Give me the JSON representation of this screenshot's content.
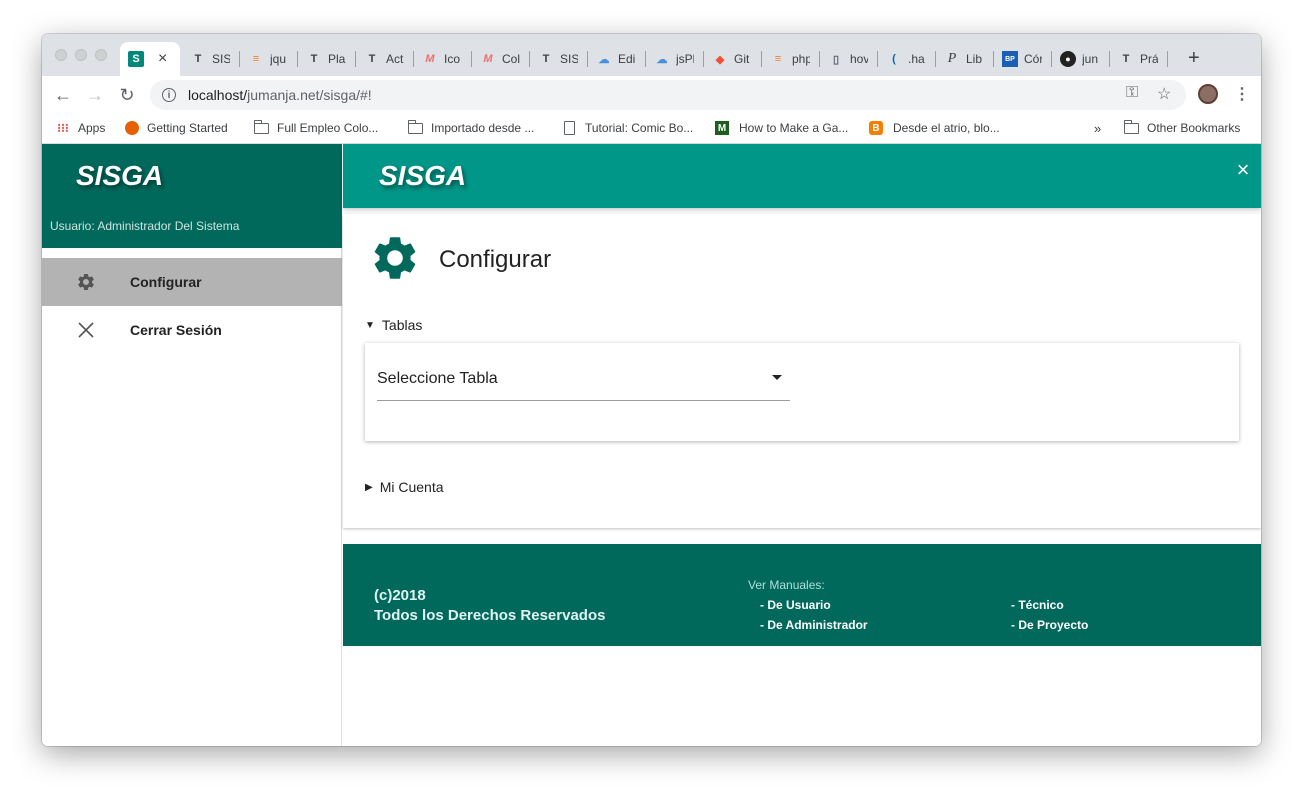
{
  "browser": {
    "tabs": [
      {
        "icon": "sisga-favicon",
        "label": "",
        "close": "×"
      },
      {
        "icon": "t-favicon",
        "label": "SIS"
      },
      {
        "icon": "stackoverflow-icon",
        "label": "jqu"
      },
      {
        "icon": "t-favicon",
        "label": "Pla"
      },
      {
        "icon": "t-favicon",
        "label": "Act"
      },
      {
        "icon": "materialize-icon",
        "label": "Ico"
      },
      {
        "icon": "materialize-icon",
        "label": "Col"
      },
      {
        "icon": "t-favicon",
        "label": "SIS"
      },
      {
        "icon": "cloud-icon",
        "label": "Edi"
      },
      {
        "icon": "cloud-icon",
        "label": "jsPl"
      },
      {
        "icon": "git-icon",
        "label": "Git"
      },
      {
        "icon": "stackoverflow-icon",
        "label": "php"
      },
      {
        "icon": "document-icon",
        "label": "hov"
      },
      {
        "icon": "jquery-icon",
        "label": ".ha"
      },
      {
        "icon": "p-favicon",
        "label": "Lib"
      },
      {
        "icon": "bp-favicon",
        "label": "Cór"
      },
      {
        "icon": "github-icon",
        "label": "jun"
      },
      {
        "icon": "t-favicon",
        "label": "Prá"
      }
    ],
    "new_tab": "+",
    "url_host": "localhost/",
    "url_path": "jumanja.net/sisga/#!",
    "bookmarks": [
      {
        "icon": "apps-grid-icon",
        "label": "Apps"
      },
      {
        "icon": "firefox-icon",
        "label": "Getting Started"
      },
      {
        "icon": "folder-icon",
        "label": "Full Empleo Colo..."
      },
      {
        "icon": "folder-icon",
        "label": "Importado desde ..."
      },
      {
        "icon": "document-icon",
        "label": "Tutorial: Comic Bo..."
      },
      {
        "icon": "m-favicon",
        "label": "How to Make a Ga..."
      },
      {
        "icon": "blogger-icon",
        "label": "Desde el atrio, blo..."
      }
    ],
    "bookmarks_overflow": "»",
    "other_bookmarks": "Other Bookmarks"
  },
  "sidebar": {
    "brand": "SISGA",
    "user": "Usuario: Administrador Del Sistema",
    "items": [
      {
        "icon": "gear-icon",
        "label": "Configurar",
        "active": true
      },
      {
        "icon": "close-icon",
        "label": "Cerrar Sesión",
        "active": false
      }
    ]
  },
  "header": {
    "brand": "SISGA",
    "close": "×"
  },
  "main": {
    "title": "Configurar",
    "section_tables": "Tablas",
    "select_value": "Seleccione Tabla",
    "section_account": "Mi Cuenta"
  },
  "footer": {
    "copyright": "(c)2018",
    "rights": "Todos los Derechos Reservados",
    "manuals_title": "Ver Manuales:",
    "links": [
      "- De Usuario",
      "- De Administrador",
      "- Técnico",
      "- De Proyecto"
    ]
  },
  "colors": {
    "primary_dark": "#00695c",
    "primary": "#009688",
    "active_item": "#b3b3b3"
  }
}
